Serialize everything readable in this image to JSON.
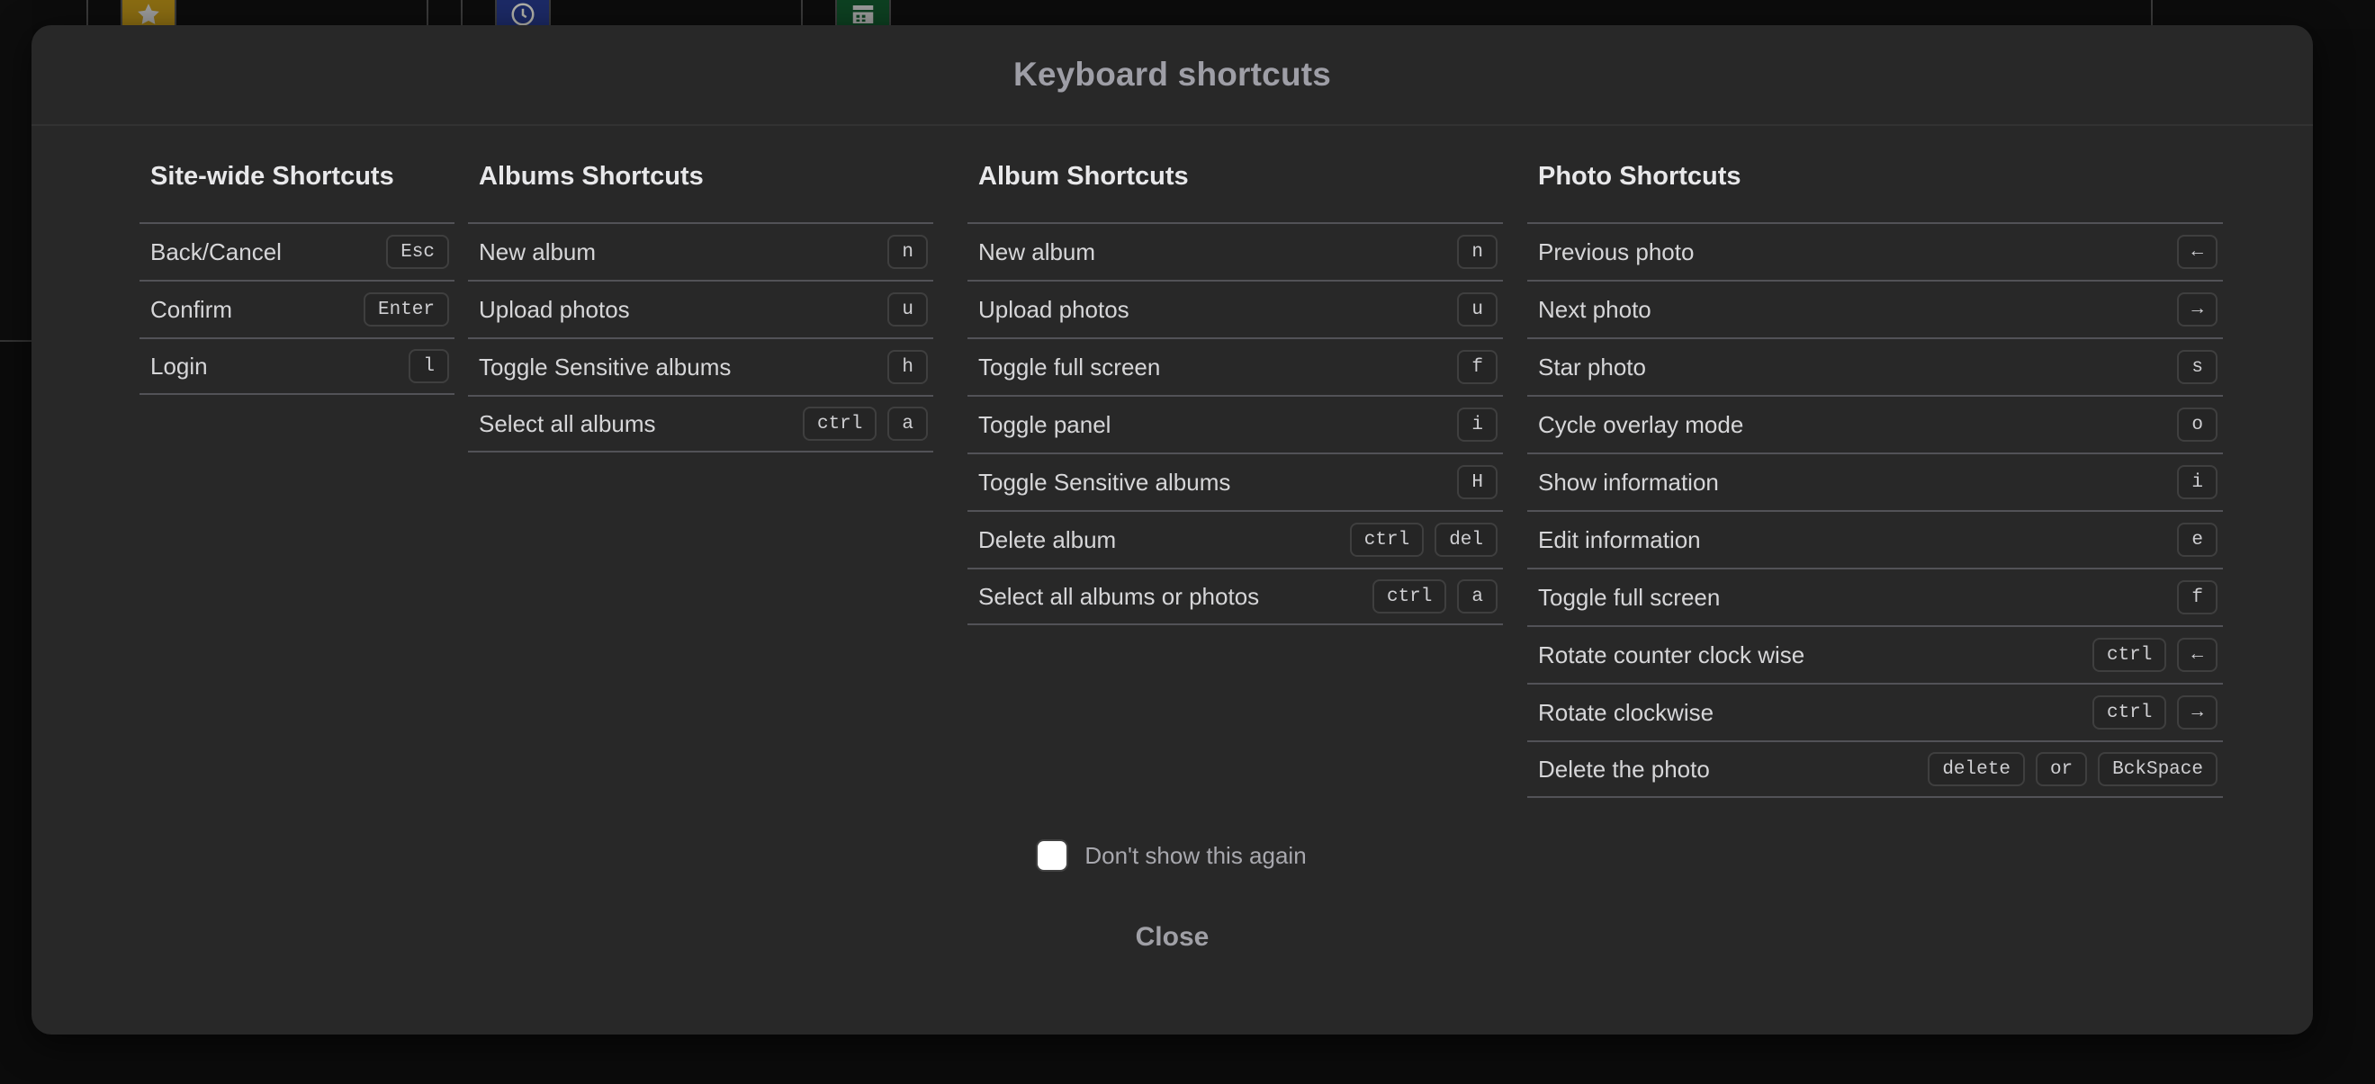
{
  "background": {
    "tiles": [
      {
        "name": "star-icon",
        "glyph": "★",
        "color": "#8a6c12"
      },
      {
        "name": "clock-icon",
        "glyph": "◷",
        "color": "#1c2a66"
      },
      {
        "name": "calendar-icon",
        "glyph": "▦",
        "color": "#0d4021"
      }
    ]
  },
  "modal": {
    "title": "Keyboard shortcuts",
    "columns": [
      {
        "title": "Site-wide Shortcuts",
        "rows": [
          {
            "label": "Back/Cancel",
            "keys": [
              "Esc"
            ]
          },
          {
            "label": "Confirm",
            "keys": [
              "Enter"
            ]
          },
          {
            "label": "Login",
            "keys": [
              "l"
            ]
          }
        ]
      },
      {
        "title": "Albums Shortcuts",
        "rows": [
          {
            "label": "New album",
            "keys": [
              "n"
            ]
          },
          {
            "label": "Upload photos",
            "keys": [
              "u"
            ]
          },
          {
            "label": "Toggle Sensitive albums",
            "keys": [
              "h"
            ]
          },
          {
            "label": "Select all albums",
            "keys": [
              "ctrl",
              "a"
            ]
          }
        ]
      },
      {
        "title": "Album Shortcuts",
        "rows": [
          {
            "label": "New album",
            "keys": [
              "n"
            ]
          },
          {
            "label": "Upload photos",
            "keys": [
              "u"
            ]
          },
          {
            "label": "Toggle full screen",
            "keys": [
              "f"
            ]
          },
          {
            "label": "Toggle panel",
            "keys": [
              "i"
            ]
          },
          {
            "label": "Toggle Sensitive albums",
            "keys": [
              "H"
            ]
          },
          {
            "label": "Delete album",
            "keys": [
              "ctrl",
              "del"
            ]
          },
          {
            "label": "Select all albums or photos",
            "keys": [
              "ctrl",
              "a"
            ]
          }
        ]
      },
      {
        "title": "Photo Shortcuts",
        "rows": [
          {
            "label": "Previous photo",
            "keys": [
              "←"
            ]
          },
          {
            "label": "Next photo",
            "keys": [
              "→"
            ]
          },
          {
            "label": "Star photo",
            "keys": [
              "s"
            ]
          },
          {
            "label": "Cycle overlay mode",
            "keys": [
              "o"
            ]
          },
          {
            "label": "Show information",
            "keys": [
              "i"
            ]
          },
          {
            "label": "Edit information",
            "keys": [
              "e"
            ]
          },
          {
            "label": "Toggle full screen",
            "keys": [
              "f"
            ]
          },
          {
            "label": "Rotate counter clock wise",
            "keys": [
              "ctrl",
              "←"
            ]
          },
          {
            "label": "Rotate clockwise",
            "keys": [
              "ctrl",
              "→"
            ]
          },
          {
            "label": "Delete the photo",
            "keys": [
              "delete",
              "or",
              "BckSpace"
            ]
          }
        ]
      }
    ],
    "footer": {
      "dont_show_label": "Don't show this again",
      "dont_show_checked": false,
      "close_label": "Close"
    }
  },
  "colors": {
    "modal_bg": "#282828",
    "page_bg": "#0b0b0b",
    "divider": "#525257",
    "title_text": "#9e9ea6",
    "label_text": "#d6d6d8",
    "key_bg": "#252525",
    "key_border": "#3f3f3f"
  }
}
